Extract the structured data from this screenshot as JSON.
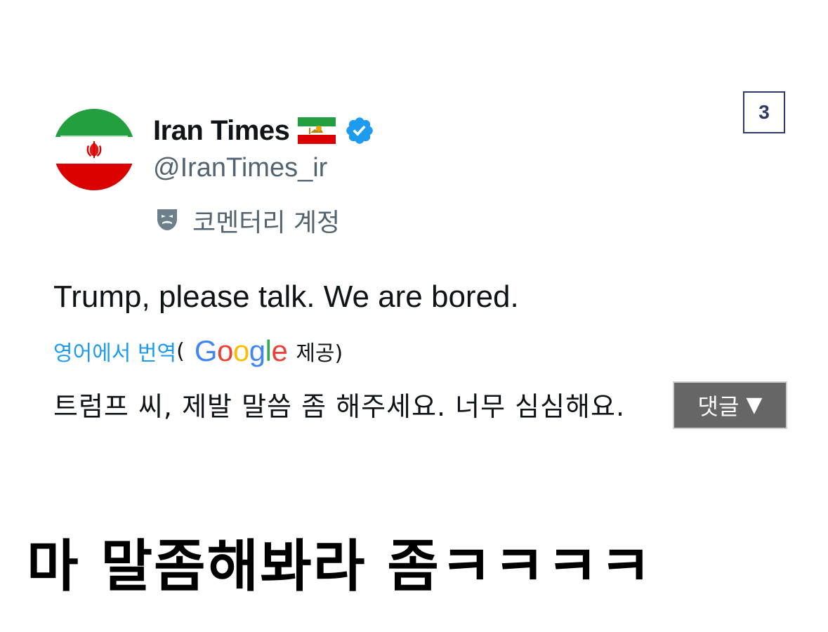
{
  "page_number": "3",
  "post": {
    "display_name": "Iran Times",
    "flag_icon": "iran-lion-and-sun-flag-icon",
    "verified_icon": "verified-badge-icon",
    "handle": "@IranTimes_ir",
    "account_type_icon": "theater-mask-icon",
    "account_type_label": "코멘터리 계정",
    "text": "Trump, please talk. We are bored.",
    "translation": {
      "link_label": "영어에서 번역",
      "open_paren": "(",
      "provider_letters": [
        "G",
        "o",
        "o",
        "g",
        "l",
        "e"
      ],
      "provided_label": "제공)",
      "translated_text": "트럼프 씨, 제발 말씀 좀 해주세요. 너무 심심해요."
    }
  },
  "comment_button": {
    "label": "댓글",
    "caret": "▼"
  },
  "caption": "마 말좀해봐라 좀ㅋㅋㅋㅋ",
  "colors": {
    "accent_link": "#1d9bf0",
    "secondary_text": "#536471",
    "verified": "#1d9bf0",
    "badge_border": "#2b3a67"
  }
}
